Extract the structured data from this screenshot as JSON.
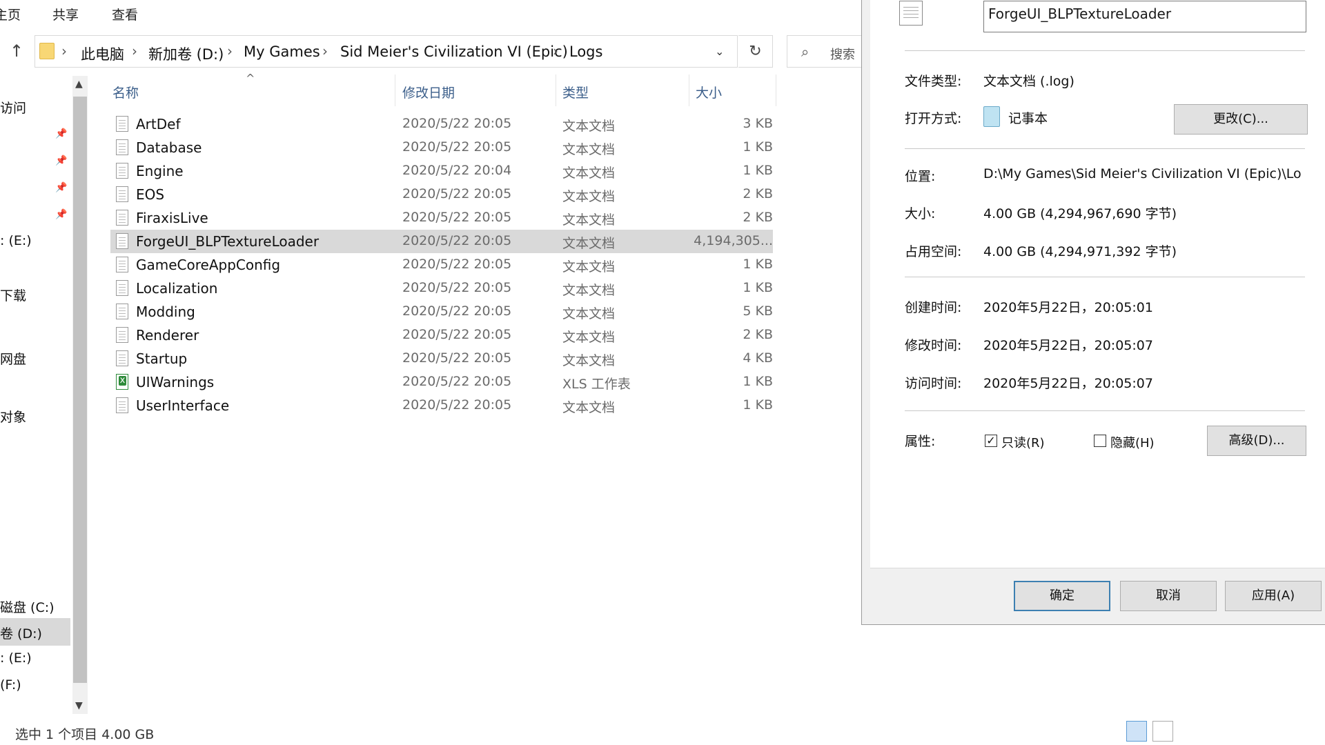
{
  "ribbon": {
    "tabs": [
      "主页",
      "共享",
      "查看"
    ]
  },
  "address": {
    "crumbs": [
      "此电脑",
      "新加卷 (D:)",
      "My Games",
      "Sid Meier's Civilization VI (Epic)",
      "Logs"
    ],
    "search_placeholder": "搜索"
  },
  "icons": {
    "up": "arrow-up-icon",
    "refresh": "refresh-icon",
    "search": "search-icon",
    "dropdown": "chevron-down-icon",
    "pin": "pin-icon"
  },
  "navpane": {
    "items": [
      "访问",
      "",
      "",
      "",
      "",
      ": (E:)",
      "",
      "下载",
      "",
      "网盘",
      "",
      "对象",
      "",
      "",
      "",
      "",
      "",
      "磁盘 (C:)",
      "卷 (D:)",
      ": (E:)",
      "(F:)"
    ]
  },
  "columns": {
    "name": "名称",
    "date": "修改日期",
    "type": "类型",
    "size": "大小"
  },
  "files": [
    {
      "name": "ArtDef",
      "date": "2020/5/22 20:05",
      "type": "文本文档",
      "size": "3 KB",
      "icon": "text-file-icon"
    },
    {
      "name": "Database",
      "date": "2020/5/22 20:05",
      "type": "文本文档",
      "size": "1 KB",
      "icon": "text-file-icon"
    },
    {
      "name": "Engine",
      "date": "2020/5/22 20:04",
      "type": "文本文档",
      "size": "1 KB",
      "icon": "text-file-icon"
    },
    {
      "name": "EOS",
      "date": "2020/5/22 20:05",
      "type": "文本文档",
      "size": "2 KB",
      "icon": "text-file-icon"
    },
    {
      "name": "FiraxisLive",
      "date": "2020/5/22 20:05",
      "type": "文本文档",
      "size": "2 KB",
      "icon": "text-file-icon"
    },
    {
      "name": "ForgeUI_BLPTextureLoader",
      "date": "2020/5/22 20:05",
      "type": "文本文档",
      "size": "4,194,305...",
      "icon": "text-file-icon",
      "selected": true
    },
    {
      "name": "GameCoreAppConfig",
      "date": "2020/5/22 20:05",
      "type": "文本文档",
      "size": "1 KB",
      "icon": "text-file-icon"
    },
    {
      "name": "Localization",
      "date": "2020/5/22 20:05",
      "type": "文本文档",
      "size": "1 KB",
      "icon": "text-file-icon"
    },
    {
      "name": "Modding",
      "date": "2020/5/22 20:05",
      "type": "文本文档",
      "size": "5 KB",
      "icon": "text-file-icon"
    },
    {
      "name": "Renderer",
      "date": "2020/5/22 20:05",
      "type": "文本文档",
      "size": "2 KB",
      "icon": "text-file-icon"
    },
    {
      "name": "Startup",
      "date": "2020/5/22 20:05",
      "type": "文本文档",
      "size": "4 KB",
      "icon": "text-file-icon"
    },
    {
      "name": "UIWarnings",
      "date": "2020/5/22 20:05",
      "type": "XLS 工作表",
      "size": "1 KB",
      "icon": "xls-file-icon"
    },
    {
      "name": "UserInterface",
      "date": "2020/5/22 20:05",
      "type": "文本文档",
      "size": "1 KB",
      "icon": "text-file-icon"
    }
  ],
  "status": {
    "text": "选中 1 个项目  4.00 GB"
  },
  "dialog": {
    "filename": "ForgeUI_BLPTextureLoader",
    "file_type_label": "文件类型:",
    "file_type": "文本文档 (.log)",
    "open_with_label": "打开方式:",
    "open_with": "记事本",
    "change_button": "更改(C)...",
    "location_label": "位置:",
    "location": "D:\\My Games\\Sid Meier's Civilization VI (Epic)\\Lo",
    "size_label": "大小:",
    "size": "4.00 GB (4,294,967,690 字节)",
    "disk_size_label": "占用空间:",
    "disk_size": "4.00 GB (4,294,971,392 字节)",
    "created_label": "创建时间:",
    "created": "2020年5月22日，20:05:01",
    "modified_label": "修改时间:",
    "modified": "2020年5月22日，20:05:07",
    "accessed_label": "访问时间:",
    "accessed": "2020年5月22日，20:05:07",
    "attributes_label": "属性:",
    "readonly_label": "只读(R)",
    "readonly_checked": true,
    "hidden_label": "隐藏(H)",
    "hidden_checked": false,
    "advanced_button": "高级(D)...",
    "ok_button": "确定",
    "cancel_button": "取消",
    "apply_button": "应用(A)"
  }
}
